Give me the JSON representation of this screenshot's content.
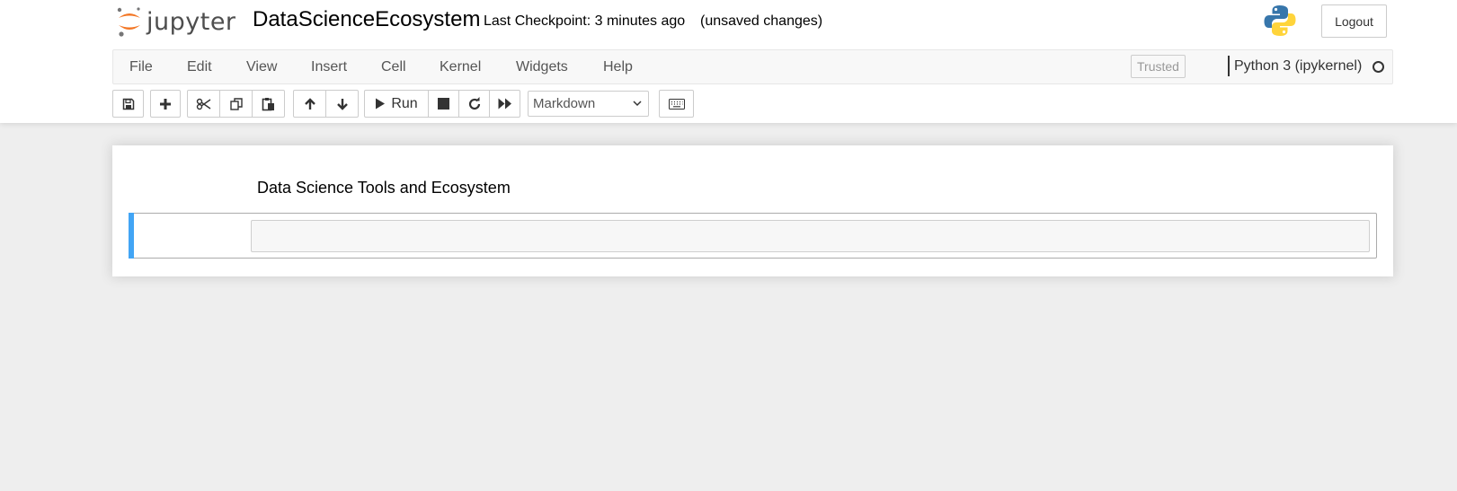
{
  "header": {
    "logo_text": "jupyter",
    "notebook_name": "DataScienceEcosystem",
    "checkpoint": "Last Checkpoint: 3 minutes ago",
    "save_status": "(unsaved changes)",
    "logout_label": "Logout",
    "kernel_logo_icon": "python-logo-icon"
  },
  "menubar": {
    "items": [
      {
        "label": "File"
      },
      {
        "label": "Edit"
      },
      {
        "label": "View"
      },
      {
        "label": "Insert"
      },
      {
        "label": "Cell"
      },
      {
        "label": "Kernel"
      },
      {
        "label": "Widgets"
      },
      {
        "label": "Help"
      }
    ],
    "trusted_label": "Trusted",
    "kernel_name": "Python 3 (ipykernel)",
    "kernel_status": "idle"
  },
  "toolbar": {
    "run_label": "Run",
    "cell_type": "Markdown",
    "icons": [
      "save-icon",
      "plus-icon",
      "scissors-icon",
      "copy-icon",
      "paste-icon",
      "arrow-up-icon",
      "arrow-down-icon",
      "play-icon",
      "stop-icon",
      "restart-icon",
      "fast-forward-icon",
      "keyboard-icon"
    ]
  },
  "notebook": {
    "markdown_heading": "Data Science Tools and Ecosystem",
    "code_cell_content": ""
  },
  "colors": {
    "selected_cell_bar": "#42a5f5",
    "logo_orange": "#f37726",
    "python_blue": "#3776ab",
    "python_yellow": "#ffd43b"
  }
}
